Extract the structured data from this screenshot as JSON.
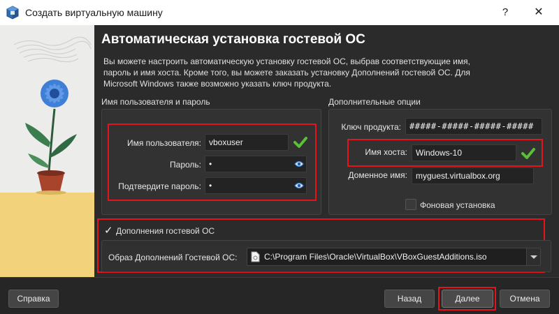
{
  "window": {
    "title": "Создать виртуальную машину",
    "help_glyph": "?",
    "close_glyph": "✕"
  },
  "header": {
    "title": "Автоматическая установка гостевой ОС",
    "description_lines": [
      "Вы можете настроить автоматическую установку гостевой ОС, выбрав соответствующие имя,",
      "пароль и имя хоста. Кроме того, вы можете заказать установку Дополнений гостевой ОС. Для",
      "Microsoft Windows также возможно указать ключ продукта."
    ]
  },
  "user_group": {
    "label": "Имя пользователя и пароль",
    "username_label": "Имя пользователя:",
    "username_value": "vboxuser",
    "password_label": "Пароль:",
    "password_value": "•",
    "confirm_label": "Подтвердите пароль:",
    "confirm_value": "•"
  },
  "extra_group": {
    "label": "Дополнительные опции",
    "product_key_label": "Ключ продукта:",
    "product_key_value": "#####-#####-#####-#####",
    "hostname_label": "Имя хоста:",
    "hostname_value": "Windows-10",
    "domain_label": "Доменное имя:",
    "domain_value": "myguest.virtualbox.org",
    "background_install_label": "Фоновая установка",
    "background_install_checked": false
  },
  "guest_additions": {
    "checkbox_label": "Дополнения гостевой ОС",
    "checked": true,
    "check_glyph": "✓",
    "iso_label": "Образ Дополнений Гостевой ОС:",
    "iso_path": "C:\\Program Files\\Oracle\\VirtualBox\\VBoxGuestAdditions.iso"
  },
  "buttons": {
    "help": "Справка",
    "back": "Назад",
    "next": "Далее",
    "cancel": "Отмена"
  },
  "colors": {
    "background": "#2b2b2b",
    "highlight_red": "#e3141b",
    "valid_green": "#5bbf3a",
    "art_yellow": "#f2d27a"
  },
  "icons": {
    "app": "virtualbox-icon",
    "valid": "checkmark-icon",
    "reveal": "eye-icon",
    "file": "file-icon"
  }
}
